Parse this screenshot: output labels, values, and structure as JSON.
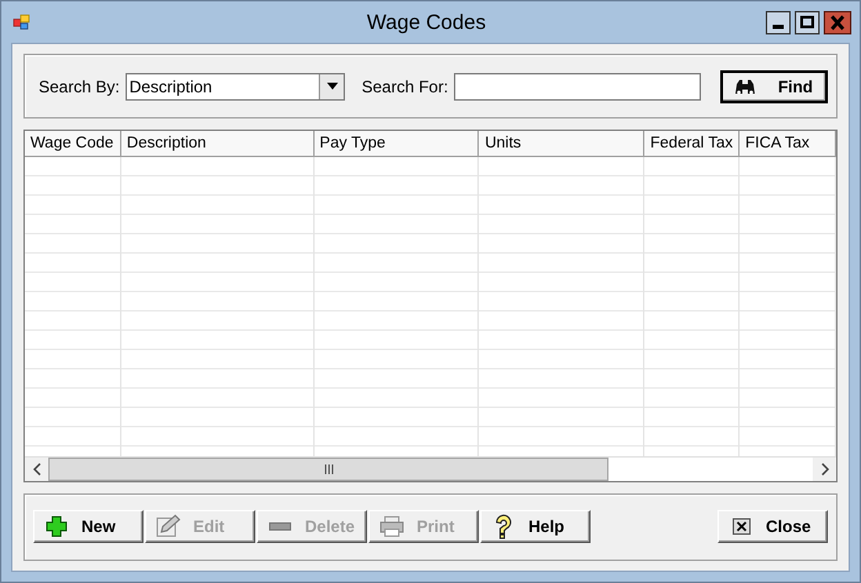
{
  "window": {
    "title": "Wage Codes"
  },
  "search": {
    "by_label": "Search By:",
    "by_value": "Description",
    "for_label": "Search For:",
    "find_button": "Find"
  },
  "table": {
    "columns": [
      "Wage Code",
      "Description",
      "Pay Type",
      "Units",
      "Federal Tax",
      "FICA Tax"
    ]
  },
  "buttons": [
    {
      "kind": "new",
      "label": "New",
      "disabled": false
    },
    {
      "kind": "edit",
      "label": "Edit",
      "disabled": true
    },
    {
      "kind": "delete",
      "label": "Delete",
      "disabled": true
    },
    {
      "kind": "print",
      "label": "Print",
      "disabled": true
    },
    {
      "kind": "help",
      "label": "Help",
      "disabled": false
    }
  ],
  "close_button": "Close"
}
